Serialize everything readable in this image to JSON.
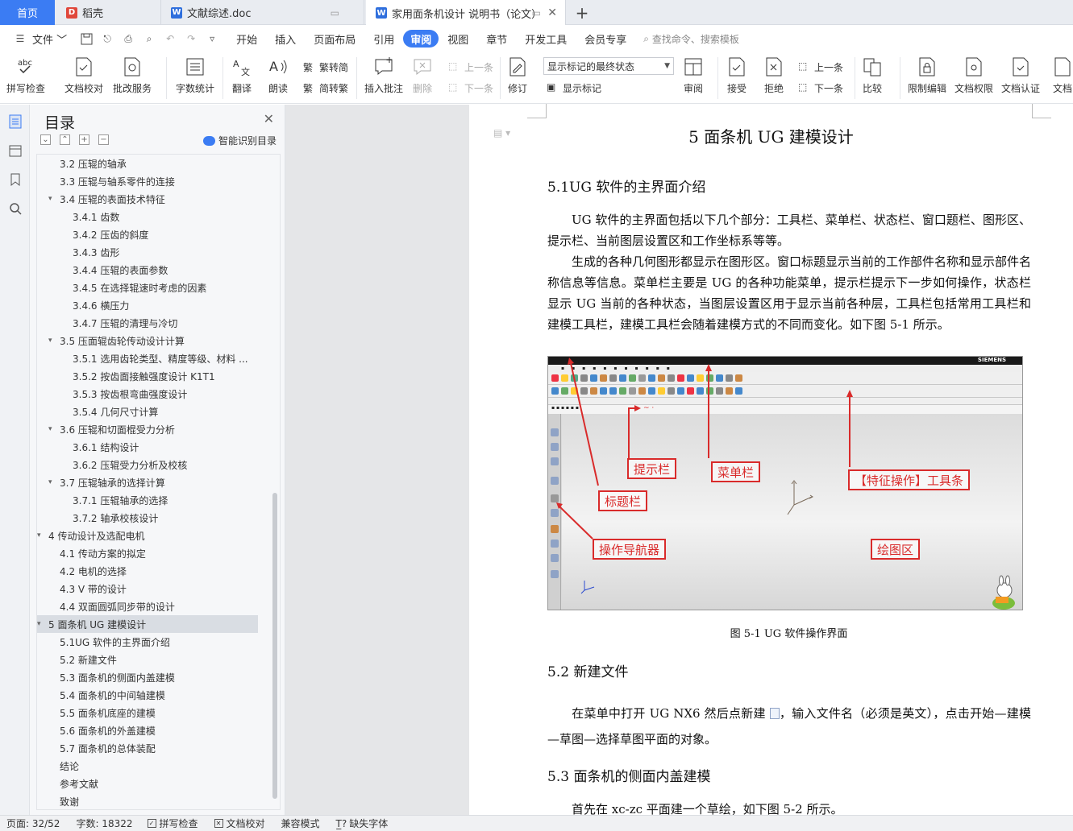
{
  "tabs": {
    "home": "首页",
    "docs": [
      {
        "label": "稻壳",
        "color": "#e0473b",
        "glyph": "D"
      },
      {
        "label": "文献综述.doc",
        "color": "#2f6fdd",
        "glyph": "W"
      },
      {
        "label": "家用面条机设计 说明书（论文）",
        "color": "#2f6fdd",
        "glyph": "W"
      }
    ],
    "new_tab": "+",
    "close": "✕"
  },
  "menubar": {
    "file": "文件",
    "items": [
      "开始",
      "插入",
      "页面布局",
      "引用",
      "审阅",
      "视图",
      "章节",
      "开发工具",
      "会员专享"
    ],
    "active": "审阅",
    "search": "查找命令、搜索模板"
  },
  "ribbon": {
    "spellcheck": "拼写检查",
    "proofread": "文档校对",
    "correction": "批改服务",
    "wordcount": "字数统计",
    "translate": "翻译",
    "read": "朗读",
    "trad": "繁转简",
    "simp": "简转繁",
    "insert_comment": "插入批注",
    "delete": "删除",
    "prev_comment": "上一条",
    "next_comment": "下一条",
    "track": "修订",
    "markup_select": "显示标记的最终状态",
    "show_markup": "显示标记",
    "review": "审阅",
    "accept": "接受",
    "reject": "拒绝",
    "prev_change": "上一条",
    "next_change": "下一条",
    "compare": "比较",
    "restrict": "限制编辑",
    "permission": "文档权限",
    "certify": "文档认证",
    "more": "文档"
  },
  "toc": {
    "title": "目录",
    "smart": "智能识别目录",
    "items": [
      {
        "label": "3.2 压辊的轴承",
        "level": 2,
        "caret": ""
      },
      {
        "label": "3.3 压辊与轴系零件的连接",
        "level": 2,
        "caret": ""
      },
      {
        "label": "3.4 压辊的表面技术特征",
        "level": 2,
        "caret": "▾"
      },
      {
        "label": "3.4.1 齿数",
        "level": 3,
        "caret": ""
      },
      {
        "label": "3.4.2 压齿的斜度",
        "level": 3,
        "caret": ""
      },
      {
        "label": "3.4.3 齿形",
        "level": 3,
        "caret": ""
      },
      {
        "label": "3.4.4 压辊的表面参数",
        "level": 3,
        "caret": ""
      },
      {
        "label": "3.4.5 在选择辊速时考虑的因素",
        "level": 3,
        "caret": ""
      },
      {
        "label": "3.4.6 横压力",
        "level": 3,
        "caret": ""
      },
      {
        "label": "3.4.7 压辊的清理与冷切",
        "level": 3,
        "caret": ""
      },
      {
        "label": "3.5 压面辊齿轮传动设计计算",
        "level": 2,
        "caret": "▾"
      },
      {
        "label": "3.5.1 选用齿轮类型、精度等级、材料 ...",
        "level": 3,
        "caret": ""
      },
      {
        "label": "3.5.2 按齿面接触强度设计 K1T1",
        "level": 3,
        "caret": ""
      },
      {
        "label": "3.5.3 按齿根弯曲强度设计",
        "level": 3,
        "caret": ""
      },
      {
        "label": "3.5.4 几何尺寸计算",
        "level": 3,
        "caret": ""
      },
      {
        "label": "3.6 压辊和切面棍受力分析",
        "level": 2,
        "caret": "▾"
      },
      {
        "label": "3.6.1 结构设计",
        "level": 3,
        "caret": ""
      },
      {
        "label": "3.6.2 压辊受力分析及校核",
        "level": 3,
        "caret": ""
      },
      {
        "label": "3.7 压辊轴承的选择计算",
        "level": 2,
        "caret": "▾"
      },
      {
        "label": "3.7.1 压辊轴承的选择",
        "level": 3,
        "caret": ""
      },
      {
        "label": "3.7.2 轴承校核设计",
        "level": 3,
        "caret": ""
      },
      {
        "label": "4 传动设计及选配电机",
        "level": 1,
        "caret": "▾"
      },
      {
        "label": "4.1 传动方案的拟定",
        "level": 2,
        "caret": ""
      },
      {
        "label": "4.2 电机的选择",
        "level": 2,
        "caret": ""
      },
      {
        "label": "4.3 V 带的设计",
        "level": 2,
        "caret": ""
      },
      {
        "label": "4.4 双面圆弧同步带的设计",
        "level": 2,
        "caret": ""
      },
      {
        "label": "5 面条机 UG 建模设计",
        "level": 1,
        "caret": "▾",
        "selected": true
      },
      {
        "label": "5.1UG 软件的主界面介绍",
        "level": 2,
        "caret": ""
      },
      {
        "label": "5.2 新建文件",
        "level": 2,
        "caret": ""
      },
      {
        "label": "5.3 面条机的侧面内盖建模",
        "level": 2,
        "caret": ""
      },
      {
        "label": "5.4 面条机的中间轴建模",
        "level": 2,
        "caret": ""
      },
      {
        "label": "5.5 面条机底座的建模",
        "level": 2,
        "caret": ""
      },
      {
        "label": "5.6 面条机的外盖建模",
        "level": 2,
        "caret": ""
      },
      {
        "label": "5.7 面条机的总体装配",
        "level": 2,
        "caret": ""
      },
      {
        "label": "结论",
        "level": 0,
        "caret": ""
      },
      {
        "label": "参考文献",
        "level": 0,
        "caret": ""
      },
      {
        "label": "致谢",
        "level": 0,
        "caret": ""
      }
    ]
  },
  "doc": {
    "chapter_title": "5  面条机 UG 建模设计",
    "s51_title": "5.1UG 软件的主界面介绍",
    "p1": "UG 软件的主界面包括以下几个部分：工具栏、菜单栏、状态栏、窗口题栏、图形区、提示栏、当前图层设置区和工作坐标系等等。",
    "p2": "生成的各种几何图形都显示在图形区。窗口标题显示当前的工作部件名称和显示部件名称信息等信息。菜单栏主要是 UG 的各种功能菜单，提示栏提示下一步如何操作，状态栏显示 UG 当前的各种状态，当图层设置区用于显示当前各种层，工具栏包括常用工具栏和建模工具栏，建模工具栏会随着建模方式的不同而变化。如下图 5-1 所示。",
    "figure_labels": {
      "prompt": "提示栏",
      "menu": "菜单栏",
      "feature": "【特征操作】工具条",
      "title": "标题栏",
      "navigator": "操作导航器",
      "drawing": "绘图区"
    },
    "figure_brand": "SIEMENS",
    "caption": "图 5-1 UG 软件操作界面",
    "s52_title": "5.2 新建文件",
    "p3a": "在菜单中打开 UG NX6 然后点新建",
    "p3b": "，输入文件名（必须是英文），点击开始—建模—草图—选择草图平面的对象。",
    "s53_title": "5.3 面条机的侧面内盖建模",
    "p4": "首先在 xc-zc 平面建一个草绘，如下图 5-2 所示。"
  },
  "status": {
    "page": "页面: 32/52",
    "words": "字数: 18322",
    "spell": "拼写检查",
    "proof": "文档校对",
    "compat": "兼容模式",
    "font": "缺失字体"
  }
}
